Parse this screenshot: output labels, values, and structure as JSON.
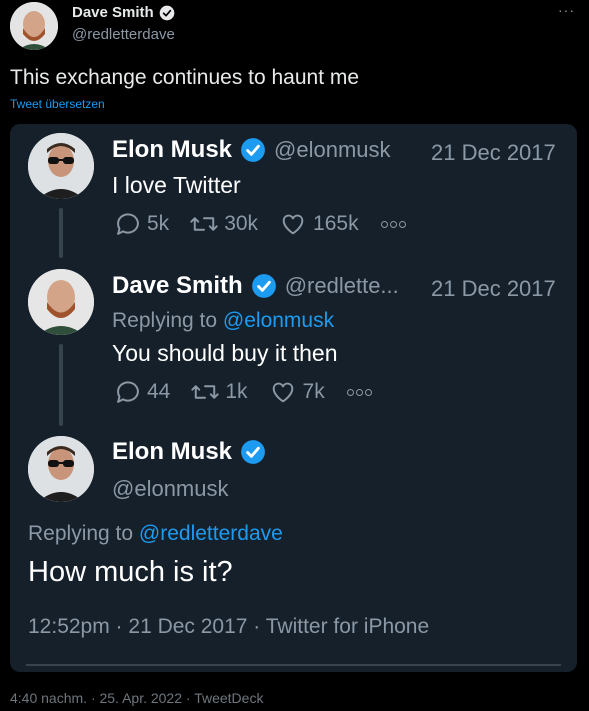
{
  "outer_tweet": {
    "author_name": "Dave Smith",
    "author_handle": "@redletterdave",
    "text": "This exchange continues to haunt me",
    "translate_label": "Tweet übersetzen",
    "more_label": "···",
    "footer": "4:40 nachm. · 25. Apr. 2022 · TweetDeck"
  },
  "screenshot": {
    "tweet1": {
      "name": "Elon Musk",
      "handle": "@elonmusk",
      "date": "21 Dec 2017",
      "text": "I love Twitter",
      "replies": "5k",
      "retweets": "30k",
      "likes": "165k"
    },
    "tweet2": {
      "name": "Dave Smith",
      "handle": "@redlette...",
      "date": "21 Dec 2017",
      "replying_to_prefix": "Replying to ",
      "replying_to": "@elonmusk",
      "text": "You should buy it then",
      "replies": "44",
      "retweets": "1k",
      "likes": "7k"
    },
    "tweet3": {
      "name": "Elon Musk",
      "handle": "@elonmusk",
      "replying_to_prefix": "Replying to ",
      "replying_to": "@redletterdave",
      "text": "How much is it?",
      "meta": "12:52pm · 21 Dec 2017 · Twitter for iPhone"
    }
  },
  "colors": {
    "background": "#000000",
    "card": "#15202b",
    "accent": "#1d9bf0",
    "muted": "#8b98a5"
  },
  "icons": [
    "verified-badge-icon",
    "reply-icon",
    "retweet-icon",
    "like-icon",
    "more-dots-icon"
  ]
}
